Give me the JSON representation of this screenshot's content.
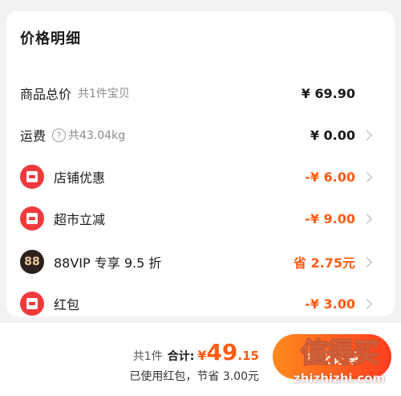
{
  "card": {
    "title": "价格明细"
  },
  "rows": {
    "goods_total": {
      "label": "商品总价",
      "sub": "共1件宝贝",
      "value": "¥ 69.90"
    },
    "shipping": {
      "label": "运费",
      "sub": "共43.04kg",
      "value": "¥ 0.00"
    },
    "store_discount": {
      "label": "店铺优惠",
      "value": "-¥ 6.00",
      "icon": "coupon-icon"
    },
    "supermarket": {
      "label": "超市立减",
      "value": "-¥ 9.00",
      "icon": "supermarket-icon"
    },
    "vip": {
      "label": "88VIP 专享 9.5 折",
      "badge": "88",
      "value": "省 2.75元"
    },
    "red_packet": {
      "label": "红包",
      "value": "-¥ 3.00",
      "icon": "red-packet-icon"
    }
  },
  "footer": {
    "count": "共1件",
    "total_label": "合计:",
    "currency": "¥",
    "amount_int": "49",
    "amount_dec": ".15",
    "savings": "已使用红包，节省 3.00元",
    "submit_label": "提交订单"
  },
  "watermark": {
    "title": "值得买",
    "url": "zhizhizhi.com"
  },
  "colors": {
    "accent": "#ff5b14",
    "badge_red": "#f0393b",
    "badge_dark": "#2c211c"
  }
}
